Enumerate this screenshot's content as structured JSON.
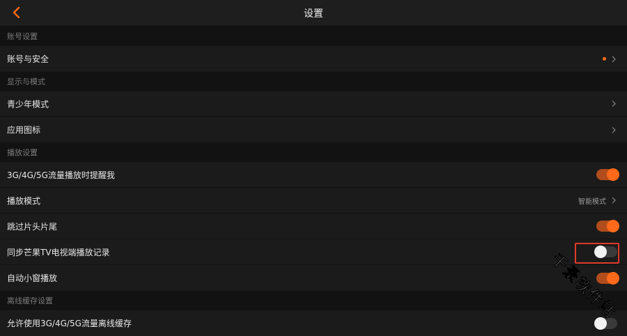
{
  "header": {
    "title": "设置"
  },
  "sections": {
    "account": {
      "title": "账号设置"
    },
    "display": {
      "title": "显示与模式"
    },
    "playback": {
      "title": "播放设置"
    },
    "offline": {
      "title": "离线缓存设置"
    }
  },
  "rows": {
    "account_security": {
      "label": "账号与安全",
      "has_notification_dot": true
    },
    "teen_mode": {
      "label": "青少年模式"
    },
    "app_icon": {
      "label": "应用图标"
    },
    "data_reminder": {
      "label": "3G/4G/5G流量播放时提醒我",
      "enabled": true
    },
    "play_mode": {
      "label": "播放模式",
      "value": "智能模式"
    },
    "skip_intro": {
      "label": "跳过片头片尾",
      "enabled": true
    },
    "sync_tv": {
      "label": "同步芒果TV电视端播放记录",
      "enabled": false
    },
    "mini_window": {
      "label": "自动小窗播放",
      "enabled": true
    },
    "offline_cache_data": {
      "label": "允许使用3G/4G/5G流量离线缓存",
      "enabled": false
    }
  },
  "watermark": {
    "text": "千景软件站"
  },
  "colors": {
    "accent": "#ff6a1a",
    "highlight": "#e23a2a",
    "background": "#121212",
    "row": "#1b1b1b"
  },
  "icons": {
    "back": "chevron-left-icon",
    "chevron": "chevron-right-icon"
  }
}
